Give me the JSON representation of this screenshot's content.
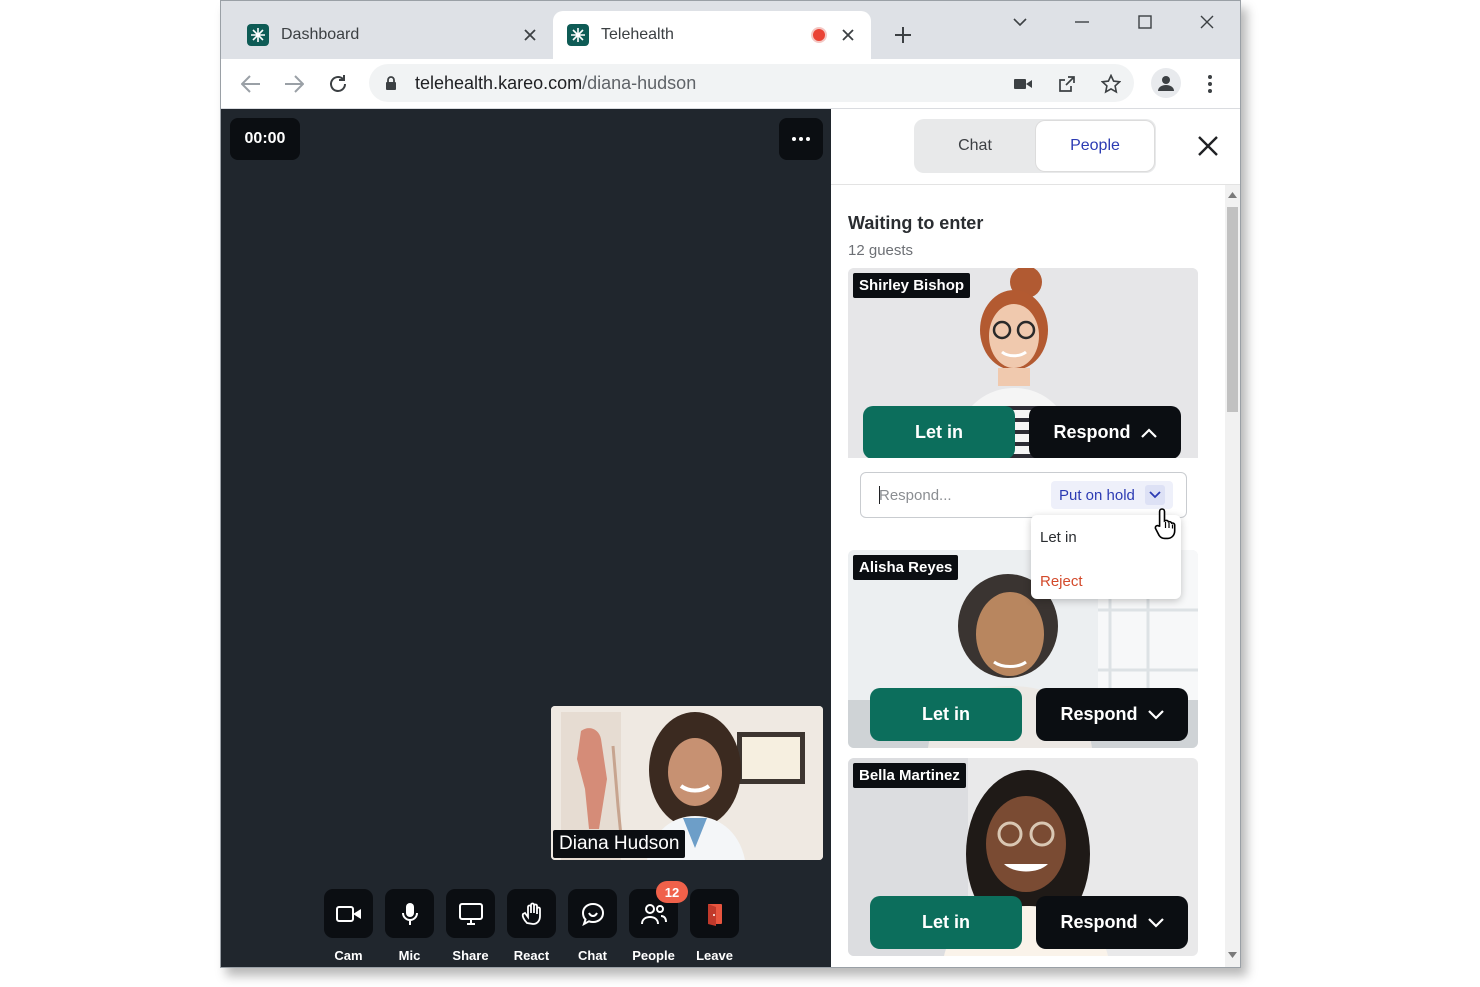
{
  "browser": {
    "tabs": [
      {
        "title": "Dashboard",
        "active": false
      },
      {
        "title": "Telehealth",
        "active": true,
        "recording": true
      }
    ],
    "url_host": "telehealth.kareo.com",
    "url_path": "/diana-hudson"
  },
  "call": {
    "timer": "00:00",
    "self_name": "Diana Hudson",
    "controls": [
      {
        "label": "Cam",
        "icon": "camera-icon"
      },
      {
        "label": "Mic",
        "icon": "microphone-icon"
      },
      {
        "label": "Share",
        "icon": "screen-share-icon"
      },
      {
        "label": "React",
        "icon": "hand-wave-icon"
      },
      {
        "label": "Chat",
        "icon": "chat-bubble-icon"
      },
      {
        "label": "People",
        "icon": "people-icon",
        "badge": "12"
      },
      {
        "label": "Leave",
        "icon": "leave-door-icon"
      }
    ]
  },
  "panel": {
    "tabs": {
      "chat": "Chat",
      "people": "People"
    },
    "active_tab": "People",
    "section_title": "Waiting to enter",
    "section_subtitle": "12 guests",
    "guests": [
      {
        "name": "Shirley Bishop",
        "let_in_label": "Let in",
        "respond_label": "Respond",
        "respond_expanded": true
      },
      {
        "name": "Alisha Reyes",
        "let_in_label": "Let in",
        "respond_label": "Respond",
        "respond_expanded": false
      },
      {
        "name": "Bella Martinez",
        "let_in_label": "Let in",
        "respond_label": "Respond",
        "respond_expanded": false
      }
    ],
    "respond_box": {
      "placeholder": "Respond...",
      "selected_action": "Put on hold",
      "options": [
        "Let in",
        "Reject"
      ]
    }
  },
  "colors": {
    "let_in_green": "#0c6e5c",
    "reject_red": "#d34a2b",
    "accent_blue": "#2c3bb3",
    "badge_red": "#f0614a",
    "video_bg": "#20262d"
  }
}
